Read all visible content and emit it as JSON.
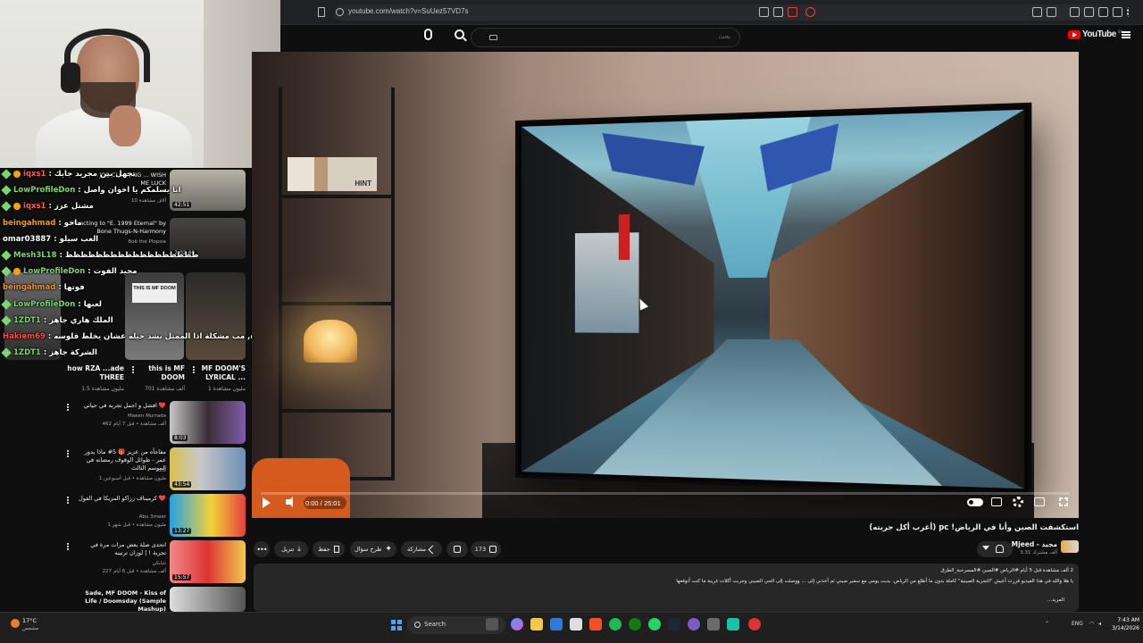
{
  "browser": {
    "url": "youtube.com/watch?v=SuUez57VD7s"
  },
  "masthead": {
    "search_placeholder": "بحث",
    "logo_text": "YouTube",
    "logo_superscript": "SA"
  },
  "chat": [
    {
      "user": "iqxs1",
      "user_color": "#ff5a5a",
      "badges": [
        "green",
        "gold"
      ],
      "message": "تجهل بين مجريد جايك"
    },
    {
      "user": "LowProfileDon",
      "user_color": "#7cd66f",
      "badges": [
        "green"
      ],
      "message": "انا يسلمكم يا اخوان واصل"
    },
    {
      "user": "iqxs1",
      "user_color": "#ff5a5a",
      "badges": [
        "green",
        "gold"
      ],
      "message": "مشتل عزز"
    },
    {
      "user": "beingahmad",
      "user_color": "#ff9900",
      "badges": [],
      "message": "ماخو"
    },
    {
      "user": "omar03887",
      "user_color": "#ffffff",
      "badges": [],
      "message": "العب سيلو"
    },
    {
      "user": "Mesh3L18",
      "user_color": "#7cd66f",
      "badges": [
        "green"
      ],
      "message": "ظظظظظظظظظظظظظظظظظظ"
    },
    {
      "user": "LowProfileDon",
      "user_color": "#7cd66f",
      "badges": [
        "green",
        "gold"
      ],
      "message": "مجيد الفوت"
    },
    {
      "user": "beingahmad",
      "user_color": "#ff9900",
      "badges": [],
      "message": "فوتها"
    },
    {
      "user": "LowProfileDon",
      "user_color": "#7cd66f",
      "badges": [
        "green"
      ],
      "message": "لعبها"
    },
    {
      "user": "1ZDT1",
      "user_color": "#7cd66f",
      "badges": [
        "green"
      ],
      "message": "الملك هاري جاهز"
    },
    {
      "user": "Hakiem69",
      "user_color": "#ff4b4b",
      "badges": [],
      "message": "مشكلة كبيرة اذا الممثل همه يتكل و يمشي و تمثيله سيء, مب مشكلة اذا الممثل يشد حيله عشان يخلط قلوسه"
    },
    {
      "user": "1ZDT1",
      "user_color": "#7cd66f",
      "badges": [
        "green"
      ],
      "message": "الشركة جاهز"
    }
  ],
  "sidebar": {
    "videos": [
      {
        "title": "JOB CLEANING ... WISH ME LUCK",
        "meta": "10 آلاف مشاهدة",
        "duration": "42:51"
      },
      {
        "title": "Reacting to \"E. 1999 Eternal\" by Bone Thugs-N-Harmony",
        "meta": "Bob the Plopsie",
        "duration": "2:02:40"
      },
      {
        "title": "THIS IS MF DOOM",
        "meta": "",
        "duration": ""
      }
    ],
    "shorts": [
      {
        "title": "how RZA ...ade THREE",
        "meta": "1.5 مليون مشاهدة"
      },
      {
        "title": "this is MF DOOM",
        "meta": "701 ألف مشاهدة"
      },
      {
        "title": "MF DOOM'S LYRICAL ...",
        "meta": "1 مليون مشاهدة"
      }
    ],
    "list": [
      {
        "title": "افشل و اجمل تجربه في حياتي ❤️",
        "channel": "Maeen Murrada",
        "meta": "462 ألف مشاهدة • قبل 7 أيام",
        "duration": "8:03"
      },
      {
        "title": "مفاجأه من عزيز 🎁 5# ماذا يدور عمر - طوائل الوقوف رمضانه في الموسم الثالث",
        "channel": "Aziz",
        "meta": "1 مليون مشاهدة • قبل أسبوعين",
        "duration": "43:54"
      },
      {
        "title": "كرميناف رزاكو المزيكا في الفول ❤️",
        "channel": "Abu 3meer",
        "meta": "1 مليون مشاهدة • قبل شهر",
        "duration": "13:27"
      },
      {
        "title": "اتحدى صلة بعض مرات مرة في تجربة ! | لوزان ترتيبه",
        "channel": "شابكي",
        "meta": "227 ألف مشاهدة • قبل 6 أيام",
        "duration": "15:57"
      },
      {
        "title": "Sade, MF DOOM - Kiss of Life / Doomsday (Sample Mashup)",
        "channel": "",
        "meta": "",
        "duration": ""
      }
    ]
  },
  "player": {
    "time": "0:00 / 25:01",
    "shelf_book_label": "HINT"
  },
  "video": {
    "title": "استكشفت الصين وأنا في الرياض! pc (أغرب أكل جربته)",
    "channel_name": "Mjeed - مجيد",
    "subscribers": "3.31 ألف مشترك",
    "likes": "173",
    "actions": [
      "مشاركة",
      "طرح سؤال",
      "حفظ",
      "تنزيل"
    ]
  },
  "description": {
    "stats": "2 ألف مشاهدة قبل 5 أيام  #الرياض #الصين #المسرحية_الطرق",
    "text": "يا هلا والله في هذا الفيديو قررت أعيش \"التجربة الصينية\" كاملة بدون ما أطلع من الرياض. بديت يومي مع سفير صيني ثم أخذني إلى ... ووصلت إلى الحي الصيني وجربت أكلات غريبة ما كنت أتوقعها",
    "more": "...المزيد"
  },
  "taskbar": {
    "temperature": "17°C",
    "weather_caption": "مشمس",
    "search_label": "Search",
    "lang": "ENG",
    "time": "7:43 AM",
    "date": "3/14/2026"
  },
  "colors": {
    "youtube_red": "#ff0000",
    "chat_green": "#7cd66f",
    "chat_red": "#ff5a5a",
    "chat_orange": "#ff9900"
  }
}
